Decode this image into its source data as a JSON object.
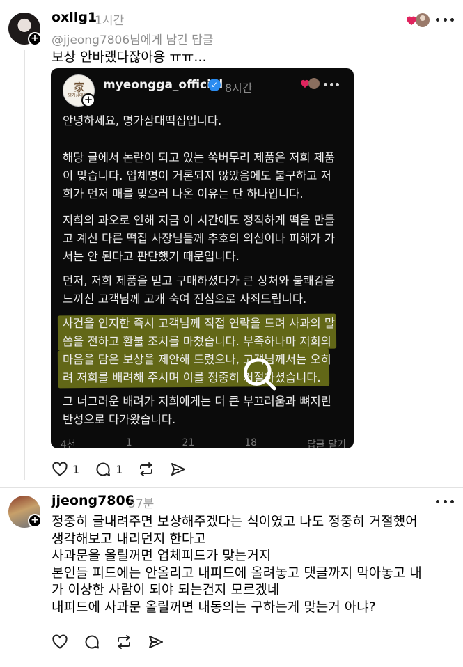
{
  "post1": {
    "username": "oxllg1",
    "time": "1시간",
    "replied_to": "@jjeong7806님에게 남긴 답글",
    "text": "보상 안바랬다잖아용 ㅠㅠ...",
    "actions": {
      "like_count": "1",
      "reply_count": "1"
    }
  },
  "embedded": {
    "username": "myeongga_official",
    "time": "8시간",
    "avatar_mark": "家",
    "avatar_sub": "명가삼대떡집",
    "paragraphs": [
      "안녕하세요, 명가삼대떡집입니다.",
      "해당 글에서 논란이 되고 있는 쑥버무리 제품은 저희 제품\n이 맞습니다. 업체명이 거론되지 않았음에도 불구하고 저\n희가 먼저 매를 맞으러 나온 이유는 단 하나입니다.",
      "저희의 과오로 인해 지금 이 시간에도 정직하게 떡을 만들\n고 계신 다른 떡집 사장님들께 추호의 의심이나 피해가 가\n서는 안 된다고 판단했기 때문입니다.",
      "먼저, 저희 제품을 믿고 구매하셨다가 큰 상처와 불쾌감을\n느끼신 고객님께 고개 숙여 진심으로 사죄드립니다.",
      "사건을 인지한 즉시 고객님께 직접 연락을 드려 사과의 말\n씀을 전하고 환불 조치를 마쳤습니다. 부족하나마 저희의\n마음을 담은 보상을 제안해 드렸으나, 고객님께서는 오히\n려 저희를 배려해 주시며 이를 정중히 거절하셨습니다.",
      "그 너그러운 배려가 저희에게는 더 큰 부끄러움과 뼈저린\n반성으로 다가왔습니다."
    ],
    "footer": [
      "4천",
      "1",
      "21",
      "18",
      "답글 달기"
    ]
  },
  "post2": {
    "username": "jjeong7806",
    "time": "57분",
    "text": "정중히 글내려주면 보상해주겠다는 식이였고 나도 정중히 거절했어\n생각해보고 내리던지 한다고\n사과문을 올릴꺼면 업체피드가 맞는거지\n본인들 피드에는 안올리고 내피드에 올려놓고 댓글까지 막아놓고 내\n가 이상한 사람이 되야 되는건지 모르겠네\n내피드에 사과문 올릴꺼면 내동의는 구하는게 맞는거 아냐?"
  },
  "colors": {
    "highlight": "#dce628",
    "verified": "#2b8cf0",
    "heart": "#e0245e"
  }
}
